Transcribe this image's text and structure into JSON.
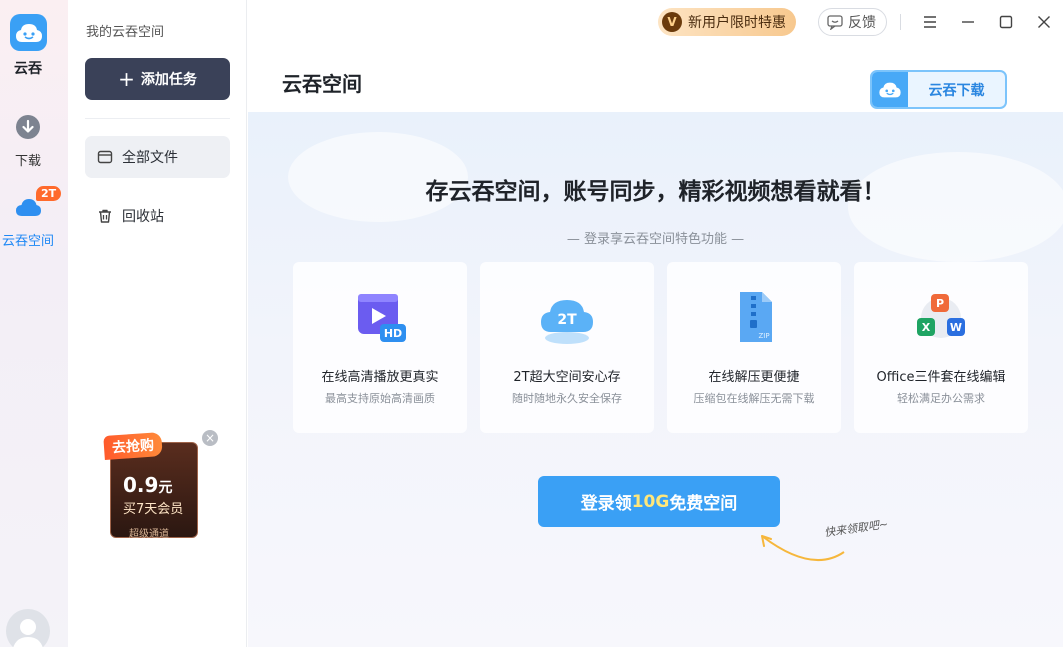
{
  "rail": {
    "app_name": "云吞",
    "items": [
      {
        "label": "下载",
        "icon": "download-icon"
      },
      {
        "label": "云吞空间",
        "icon": "cloud-icon",
        "badge": "2T"
      }
    ]
  },
  "sidebar": {
    "title": "我的云吞空间",
    "add_task": "添加任务",
    "items": [
      {
        "label": "全部文件",
        "icon": "folder-icon"
      },
      {
        "label": "回收站",
        "icon": "trash-icon"
      }
    ],
    "promo": {
      "tag": "去抢购",
      "price": "0.9",
      "unit": "元",
      "desc": "买7天会员",
      "foot": "超级通道"
    }
  },
  "topbar": {
    "vip_label": "新用户限时特惠",
    "vip_badge": "V",
    "feedback": "反馈"
  },
  "main": {
    "title": "云吞空间",
    "download_button": "云吞下载",
    "hero_title": "存云吞空间，账号同步，精彩视频想看就看！",
    "hero_sub": "— 登录享云吞空间特色功能 —",
    "cards": [
      {
        "title": "在线高清播放更真实",
        "desc": "最高支持原始高清画质",
        "icon": "hd-video-icon"
      },
      {
        "title": "2T超大空间安心存",
        "desc": "随时随地永久安全保存",
        "icon": "cloud-storage-icon",
        "icon_text": "2T"
      },
      {
        "title": "在线解压更便捷",
        "desc": "压缩包在线解压无需下载",
        "icon": "zip-file-icon"
      },
      {
        "title": "Office三件套在线编辑",
        "desc": "轻松满足办公需求",
        "icon": "office-icon"
      }
    ],
    "login_prefix": "登录领",
    "login_highlight": "10G",
    "login_suffix": "免费空间",
    "hint": "快来领取吧~"
  },
  "colors": {
    "accent": "#3aa0f5",
    "dark_button": "#3a4158",
    "badge": "#ff6a2c"
  }
}
